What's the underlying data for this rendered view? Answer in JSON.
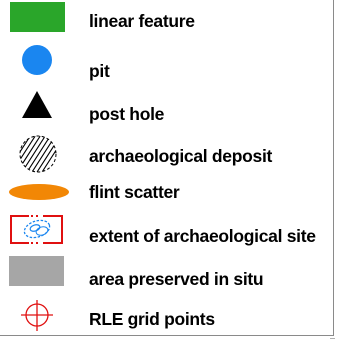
{
  "legend": {
    "items": [
      {
        "label": "linear feature",
        "symbol": "green-rectangle",
        "color": "#2aa62a"
      },
      {
        "label": "pit",
        "symbol": "blue-circle",
        "color": "#1a86f0"
      },
      {
        "label": "post hole",
        "symbol": "black-triangle",
        "color": "#000000"
      },
      {
        "label": "archaeological deposit",
        "symbol": "hatched-circle",
        "color": "#000000"
      },
      {
        "label": "flint scatter",
        "symbol": "orange-ellipse",
        "color": "#f28705"
      },
      {
        "label": "extent of archaeological site",
        "symbol": "red-extent-box",
        "color": "#e01010"
      },
      {
        "label": "area preserved in situ",
        "symbol": "grey-rectangle",
        "color": "#a6a6a6"
      },
      {
        "label": "RLE grid points",
        "symbol": "red-crosshair",
        "color": "#e01010"
      }
    ]
  }
}
